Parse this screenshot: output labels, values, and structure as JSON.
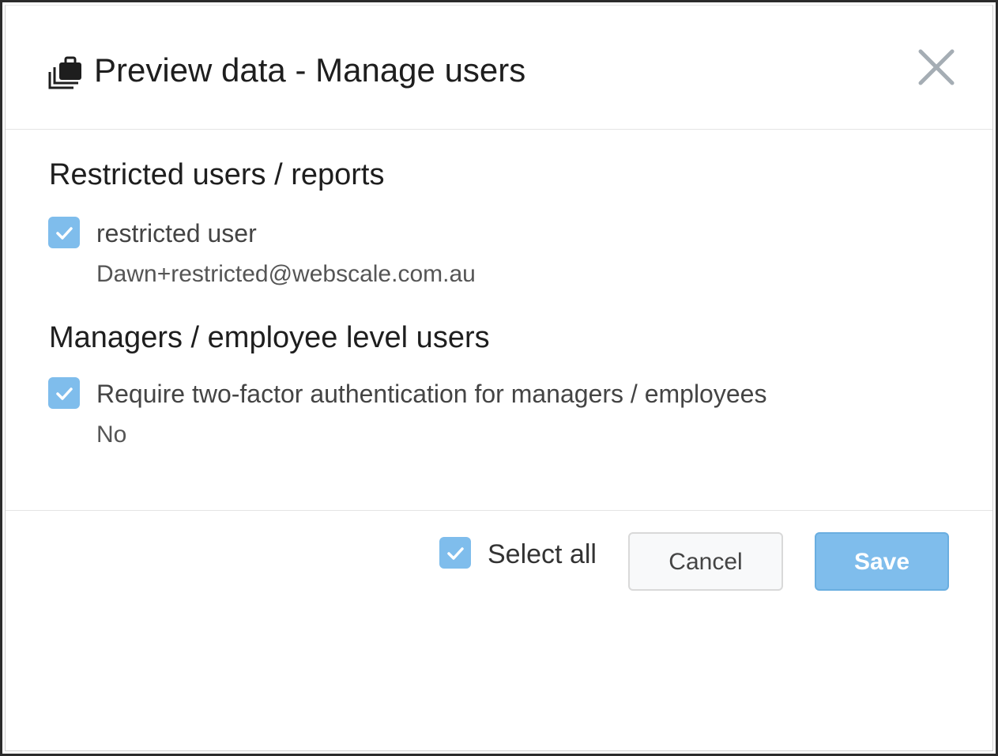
{
  "dialog": {
    "title": "Preview data - Manage users",
    "title_icon": "briefcase-stack-icon",
    "close_icon": "close-icon"
  },
  "sections": [
    {
      "title": "Restricted users / reports",
      "option": {
        "label": "restricted user",
        "detail": "Dawn+restricted@webscale.com.au",
        "checked": true
      }
    },
    {
      "title": "Managers / employee level users",
      "option": {
        "label": "Require two-factor authentication for managers / employees",
        "detail": "No",
        "checked": true
      }
    }
  ],
  "footer": {
    "select_all_label": "Select all",
    "select_all_checked": true,
    "cancel_label": "Cancel",
    "save_label": "Save"
  },
  "colors": {
    "accent": "#7fbdec",
    "text": "#1e1e1e",
    "muted": "#555555",
    "close_icon": "#a5adb4"
  }
}
